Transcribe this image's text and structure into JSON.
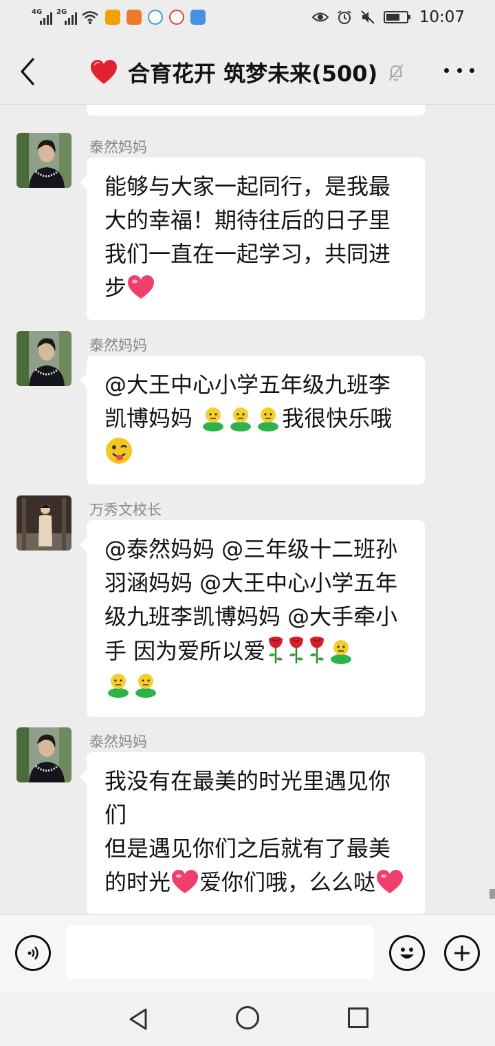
{
  "status_bar": {
    "signal_1_label": "4G",
    "signal_2_label": "2G",
    "time": "10:07",
    "icons": [
      "signal-4g-icon",
      "signal-2g-icon",
      "wifi-icon",
      "app-notification-icons",
      "eye-icon",
      "alarm-icon",
      "mute-icon",
      "battery-icon"
    ]
  },
  "header": {
    "title": "合育花开 筑梦未来(500)",
    "icons": [
      "back-arrow-icon",
      "heart-emoji-icon",
      "bell-muted-icon",
      "more-icon"
    ]
  },
  "messages": [
    {
      "sender": "泰然妈妈",
      "avatar": "avatar-taoran",
      "lines": [
        [
          {
            "t": "能够与大家一起同行，是我最"
          }
        ],
        [
          {
            "t": "大的幸福！期待往后的日子里"
          }
        ],
        [
          {
            "t": "我们一直在一起学习，共同进"
          }
        ],
        [
          {
            "t": "步"
          },
          {
            "e": "heart"
          }
        ]
      ]
    },
    {
      "sender": "泰然妈妈",
      "avatar": "avatar-taoran",
      "lines": [
        [
          {
            "t": "@大王中心小学五年级九班李"
          }
        ],
        [
          {
            "t": "凯博妈妈 "
          },
          {
            "e": "person"
          },
          {
            "e": "person"
          },
          {
            "e": "person"
          },
          {
            "t": "我很快乐哦"
          }
        ],
        [
          {
            "e": "wink"
          }
        ]
      ]
    },
    {
      "sender": "万秀文校长",
      "avatar": "avatar-principal",
      "lines": [
        [
          {
            "t": "@泰然妈妈 @三年级十二班孙"
          }
        ],
        [
          {
            "t": "羽涵妈妈 @大王中心小学五年"
          }
        ],
        [
          {
            "t": "级九班李凯博妈妈 @大手牵小"
          }
        ],
        [
          {
            "t": "手  因为爱所以爱"
          },
          {
            "e": "rose"
          },
          {
            "e": "rose"
          },
          {
            "e": "rose"
          },
          {
            "e": "person"
          }
        ],
        [
          {
            "e": "person"
          },
          {
            "e": "person"
          }
        ]
      ]
    },
    {
      "sender": "泰然妈妈",
      "avatar": "avatar-taoran",
      "lines": [
        [
          {
            "t": "我没有在最美的时光里遇见你"
          }
        ],
        [
          {
            "t": "们"
          }
        ],
        [
          {
            "t": "但是遇见你们之后就有了最美"
          }
        ],
        [
          {
            "t": "的时光"
          },
          {
            "e": "heart"
          },
          {
            "t": "爱你们哦，么么哒"
          },
          {
            "e": "heart"
          }
        ]
      ]
    }
  ],
  "input_bar": {
    "value": "",
    "icons": [
      "voice-input-icon",
      "emoji-icon",
      "add-icon"
    ]
  },
  "nav_bar": {
    "icons": [
      "nav-back-icon",
      "nav-home-icon",
      "nav-recent-icon"
    ]
  },
  "colors": {
    "background": "#ededed",
    "bubble": "#ffffff",
    "sender_name": "#888888",
    "heart": "#e8283c"
  }
}
